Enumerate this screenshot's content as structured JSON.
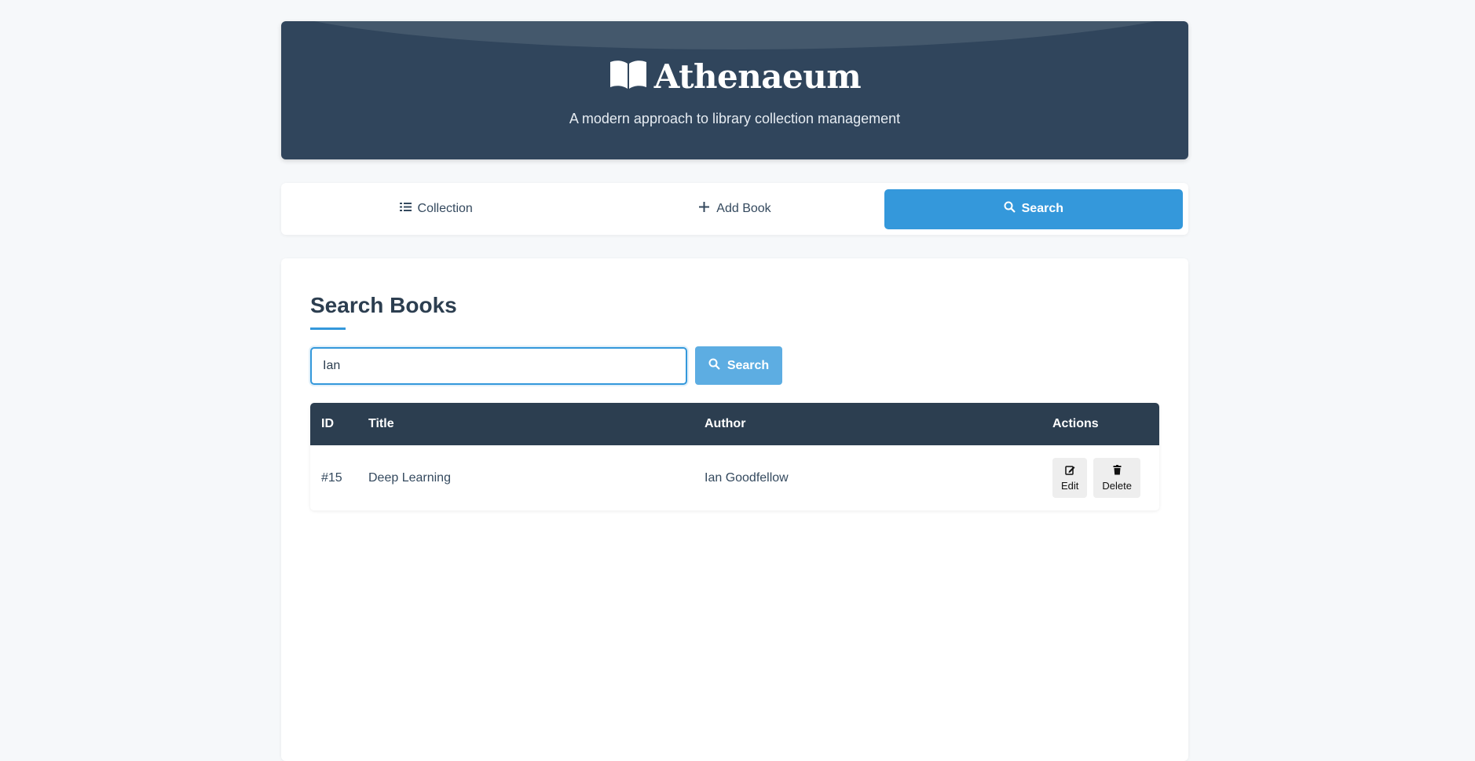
{
  "header": {
    "title": "Athenaeum",
    "tagline": "A modern approach to library collection management",
    "logo_icon": "open-book-icon"
  },
  "nav": {
    "tabs": [
      {
        "label": "Collection",
        "icon": "list-icon",
        "active": false
      },
      {
        "label": "Add Book",
        "icon": "plus-icon",
        "active": false
      },
      {
        "label": "Search",
        "icon": "search-icon",
        "active": true
      }
    ]
  },
  "main": {
    "title": "Search Books",
    "search": {
      "value": "Ian",
      "button_label": "Search"
    },
    "table": {
      "headers": [
        "ID",
        "Title",
        "Author",
        "Actions"
      ],
      "rows": [
        {
          "id": "#15",
          "title": "Deep Learning",
          "author": "Ian Goodfellow",
          "edit_label": "Edit",
          "delete_label": "Delete"
        }
      ]
    }
  },
  "colors": {
    "primary": "#3498db",
    "dark": "#2c3e50",
    "background": "#f6f8fa"
  }
}
